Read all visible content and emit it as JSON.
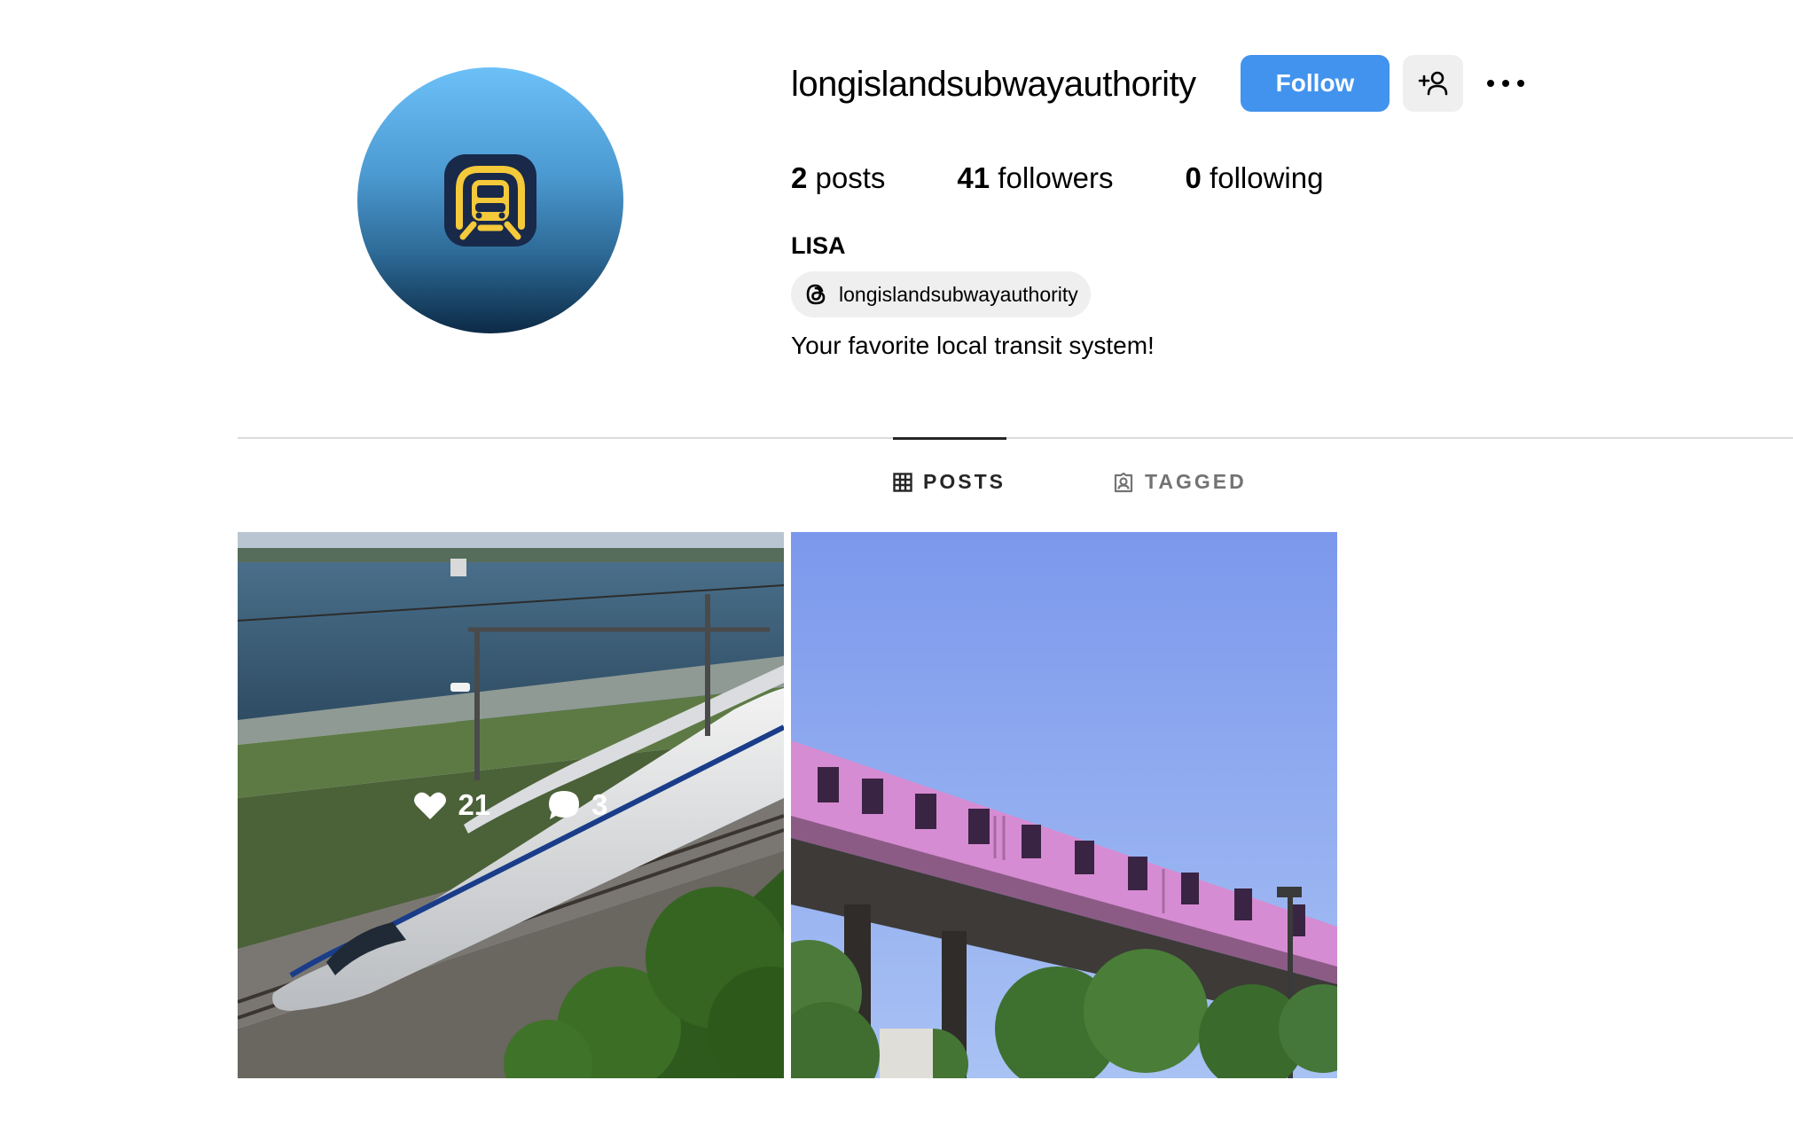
{
  "profile": {
    "username": "longislandsubwayauthority",
    "follow_label": "Follow",
    "display_name": "LISA",
    "threads_handle": "longislandsubwayauthority",
    "bio": "Your favorite local transit system!",
    "stats": {
      "posts_count": "2",
      "posts_label": "posts",
      "followers_count": "41",
      "followers_label": "followers",
      "following_count": "0",
      "following_label": "following"
    }
  },
  "tabs": [
    {
      "label": "POSTS",
      "icon": "grid-icon",
      "active": true
    },
    {
      "label": "TAGGED",
      "icon": "tag-user-icon",
      "active": false
    }
  ],
  "posts": [
    {
      "likes": "21",
      "comments": "3"
    },
    {}
  ],
  "colors": {
    "accent": "#4293ee",
    "avatar_top": "#6cc0f8",
    "avatar_bottom": "#0c2a46",
    "logo_yellow": "#f4c93a"
  }
}
